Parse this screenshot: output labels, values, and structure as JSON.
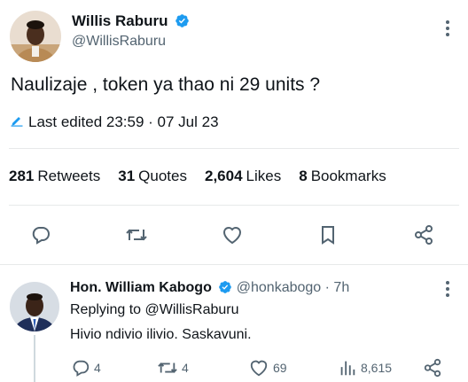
{
  "tweet": {
    "author_name": "Willis Raburu",
    "author_handle": "@WillisRaburu",
    "text": "Naulizaje , token ya thao ni 29 units ?",
    "edited": "Last edited 23:59 · 07 Jul 23"
  },
  "stats": [
    {
      "count": "281",
      "label": "Retweets"
    },
    {
      "count": "31",
      "label": "Quotes"
    },
    {
      "count": "2,604",
      "label": "Likes"
    },
    {
      "count": "8",
      "label": "Bookmarks"
    }
  ],
  "reply": {
    "author_name": "Hon. William Kabogo",
    "author_handle": "@honkabogo",
    "time": "· 7h",
    "replying_to": "Replying to @WillisRaburu",
    "text": "Hivio ndivio ilivio. Saskavuni.",
    "replies": "4",
    "retweets": "4",
    "likes": "69",
    "views": "8,615"
  },
  "colors": {
    "verified": "#1d9bf0",
    "secondary_text": "#536471",
    "icon": "#536471",
    "divider": "#e7e9ea"
  }
}
